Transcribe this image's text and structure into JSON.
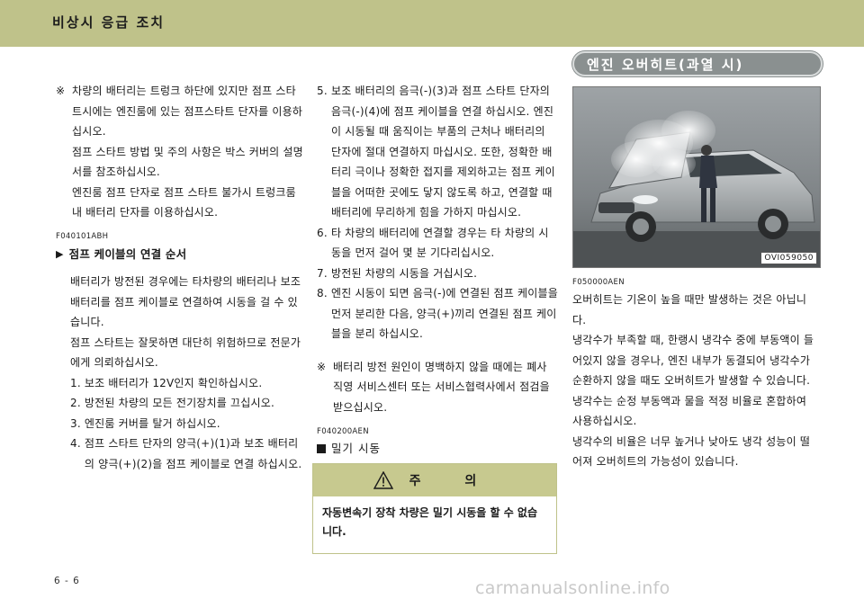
{
  "header": {
    "title": "비상시 응급 조치"
  },
  "col1": {
    "note_mark": "※",
    "note_paragraphs": [
      "차량의 배터리는 트렁크 하단에 있지만 점프 스타트시에는 엔진룸에 있는 점프스타트 단자를 이용하십시오.",
      "점프 스타트 방법 및 주의 사항은 박스 커버의 설명서를 참조하십시오.",
      "엔진룸 점프 단자로 점프 스타트 불가시 트렁크룸내 배터리 단자를 이용하십시오."
    ],
    "code": "F040101ABH",
    "heading_marker": "▶",
    "heading": "점프 케이블의 연결 순서",
    "intro_paragraphs": [
      "배터리가 방전된 경우에는 타차량의 배터리나 보조 배터리를 점프 케이블로 연결하여 시동을 걸 수 있습니다.",
      "점프 스타트는 잘못하면 대단히 위험하므로 전문가에게 의뢰하십시오."
    ],
    "steps": [
      {
        "num": "1.",
        "text": "보조 배터리가 12V인지 확인하십시오."
      },
      {
        "num": "2.",
        "text": "방전된 차량의 모든 전기장치를 끄십시오."
      },
      {
        "num": "3.",
        "text": "엔진룸 커버를 탈거 하십시오."
      },
      {
        "num": "4.",
        "text": "점프 스타트 단자의 양극(+)(1)과 보조 배터리의 양극(+)(2)을 점프 케이블로 연결 하십시오."
      }
    ]
  },
  "col2": {
    "steps": [
      {
        "num": "5.",
        "text": "보조 배터리의 음극(-)(3)과 점프 스타트 단자의 음극(-)(4)에 점프 케이블을 연결 하십시오. 엔진이 시동될 때 움직이는 부품의 근처나 배터리의 단자에 절대 연결하지 마십시오. 또한, 정확한 배터리 극이나 정확한 접지를 제외하고는 점프 케이블을 어떠한 곳에도 닿지 않도록 하고, 연결할 때 배터리에 무리하게 힘을 가하지 마십시오."
      },
      {
        "num": "6.",
        "text": "타 차량의 배터리에 연결할 경우는 타 차량의 시동을 먼저 걸어 몇 분 기다리십시오."
      },
      {
        "num": "7.",
        "text": "방전된 차량의 시동을 거십시오."
      },
      {
        "num": "8.",
        "text": "엔진 시동이 되면 음극(-)에 연결된 점프 케이블을 먼저 분리한 다음, 양극(+)끼리 연결된 점프 케이블을 분리 하십시오."
      }
    ],
    "note_mark": "※",
    "note": "배터리 방전 원인이 명백하지 않을 때에는 폐사 직영 서비스센터 또는 서비스협력사에서 점검을 받으십시오.",
    "code": "F040200AEN",
    "square_heading": "밀기 시동"
  },
  "caution": {
    "title": "주 의",
    "icon": "warning-triangle-icon",
    "text": "자동변속기 장착 차량은 밀기 시동을 할 수 없습니다."
  },
  "col3": {
    "section_title": "엔진 오버히트(과열 시)",
    "photo_code": "OVI059050",
    "code": "F050000AEN",
    "paragraphs": [
      "오버히트는 기온이 높을 때만 발생하는 것은 아닙니다.",
      "냉각수가 부족할 때, 한랭시 냉각수 중에 부동액이 들어있지 않을 경우나, 엔진 내부가 동결되어 냉각수가 순환하지 않을 때도 오버히트가 발생할 수 있습니다.",
      "냉각수는 순정 부동액과 물을 적정 비율로 혼합하여 사용하십시오.",
      "냉각수의 비율은 너무 높거나 낮아도 냉각 성능이 떨어져 오버히트의 가능성이 있습니다."
    ]
  },
  "footer": {
    "page_number": "6 - 6",
    "watermark": "carmanualsonline.info"
  },
  "colors": {
    "header_band": "#bfc28a",
    "pill": "#8a9090"
  }
}
